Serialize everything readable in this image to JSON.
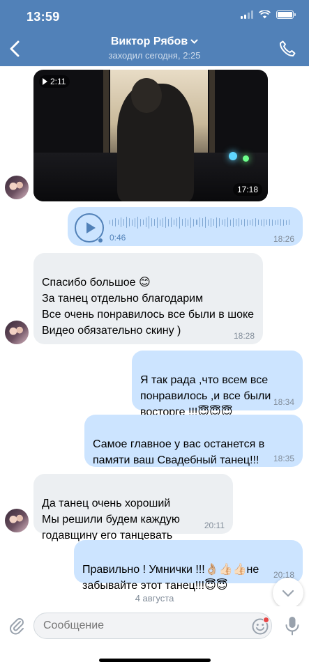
{
  "status_bar": {
    "time": "13:59"
  },
  "header": {
    "contact_name": "Виктор Рябов",
    "contact_status": "заходил сегодня, 2:25",
    "back_icon": "chevron-left-icon",
    "call_icon": "phone-icon",
    "dropdown_icon": "chevron-down-icon"
  },
  "colors": {
    "header": "#5181b8",
    "incoming_bubble": "#eceff2",
    "outgoing_bubble": "#cce4ff",
    "meta": "#818c99"
  },
  "video": {
    "badge_duration": "2:11",
    "time": "17:18"
  },
  "voice": {
    "duration": "0:46",
    "time": "18:26",
    "progress": 0
  },
  "messages": [
    {
      "direction": "in",
      "text": "Спасибо большое 😊\nЗа танец отдельно благодарим\nВсе очень понравилось все были в шоке\nВидео обязательно скину )",
      "time": "18:28"
    },
    {
      "direction": "out",
      "text": "Я так рада ,что всем все понравилось ,и все были восторге !!!😇😇😇",
      "time": "18:34"
    },
    {
      "direction": "out",
      "text": "Самое главное у вас останется в памяти ваш Свадебный танец!!!",
      "time": "18:35"
    },
    {
      "direction": "in",
      "text": "Да танец очень хороший\nМы решили будем каждую годавщину его танцевать",
      "time": "20:11"
    },
    {
      "direction": "out",
      "text": "Правильно ! Умнички !!!👌🏼👍🏻👍🏻не забывайте этот танец!!!😇😇",
      "time": "20:18"
    }
  ],
  "date_separator": "4 августа",
  "composer": {
    "placeholder": "Сообщение",
    "attach_icon": "paperclip-icon",
    "emoji_icon": "smiley-icon",
    "mic_icon": "microphone-icon"
  }
}
